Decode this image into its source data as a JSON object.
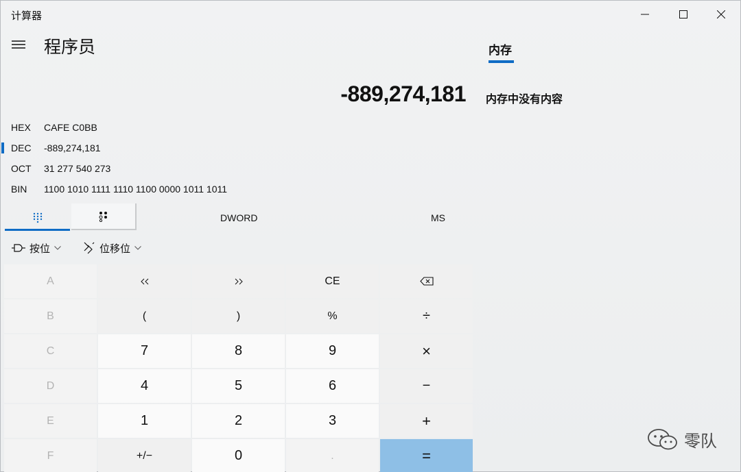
{
  "window": {
    "title": "计算器"
  },
  "header": {
    "mode_title": "程序员"
  },
  "memory": {
    "tab_label": "内存",
    "empty_text": "内存中没有内容"
  },
  "display": {
    "value": "-889,274,181"
  },
  "radix": [
    {
      "label": "HEX",
      "value": "CAFE C0BB",
      "selected": false
    },
    {
      "label": "DEC",
      "value": "-889,274,181",
      "selected": true
    },
    {
      "label": "OCT",
      "value": "31 277 540 273",
      "selected": false
    },
    {
      "label": "BIN",
      "value": "1100 1010 1111 1110 1100 0000 1011 1011",
      "selected": false
    }
  ],
  "modes": {
    "word_size": "DWORD",
    "memory_store": "MS"
  },
  "operations": {
    "bitwise": "按位",
    "bitshift": "位移位"
  },
  "keys": {
    "A": "A",
    "B": "B",
    "C": "C",
    "D": "D",
    "E": "E",
    "F": "F",
    "lsh": "<<",
    "rsh": ">>",
    "ce": "CE",
    "lparen": "(",
    "rparen": ")",
    "mod": "%",
    "divide": "÷",
    "seven": "7",
    "eight": "8",
    "nine": "9",
    "multiply": "×",
    "four": "4",
    "five": "5",
    "six": "6",
    "minus": "−",
    "one": "1",
    "two": "2",
    "three": "3",
    "plus": "+",
    "negate": "+/−",
    "zero": "0",
    "decimal": ".",
    "equals": "="
  },
  "watermark": {
    "text": "零队"
  }
}
